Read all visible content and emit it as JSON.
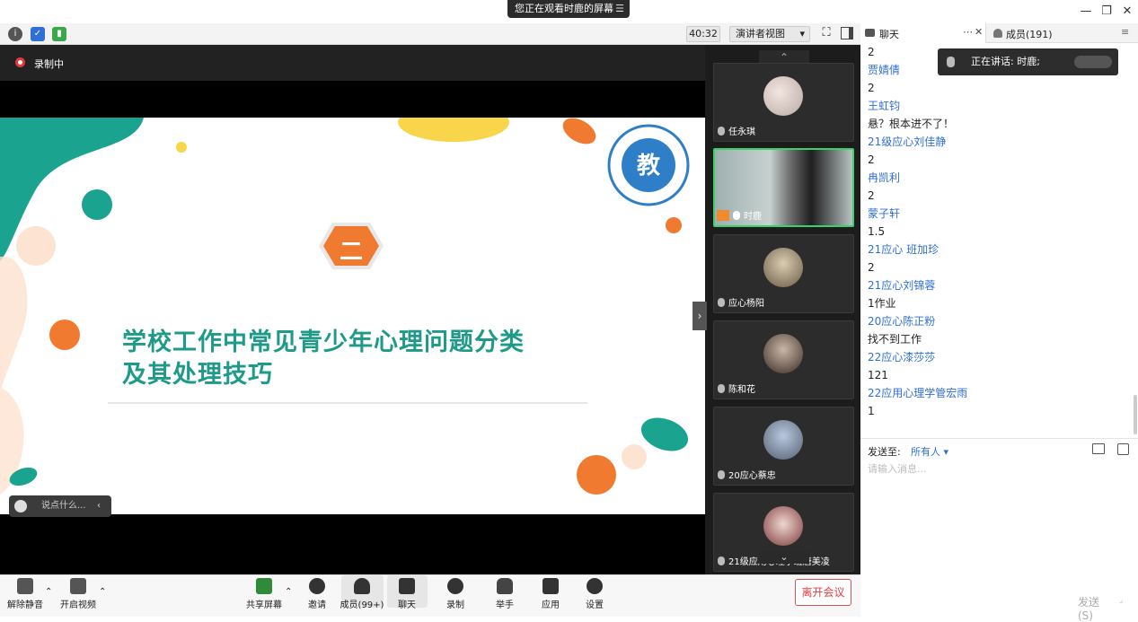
{
  "viewing_banner": "您正在观看时鹿的屏幕",
  "toolbar": {
    "timer": "40:32",
    "view_mode": "演讲者视图"
  },
  "recording": {
    "label": "录制中"
  },
  "slide": {
    "badge": "二",
    "title_line1": "学校工作中常见青少年心理问题分类",
    "title_line2": "及其处理技巧"
  },
  "chat_input_pill": "说点什么...",
  "gallery": [
    {
      "name": "任永琪"
    },
    {
      "name": "时鹿"
    },
    {
      "name": "应心杨阳"
    },
    {
      "name": "陈和花"
    },
    {
      "name": "20应心蔡忠"
    },
    {
      "name": "21级应用心理学班唐美凌"
    }
  ],
  "panel": {
    "chat_tab": "聊天",
    "members_tab": "成员(191)"
  },
  "speaker_popup": "正在讲话: 时鹿;",
  "chat_messages": [
    {
      "type": "text",
      "text": "2"
    },
    {
      "type": "name",
      "text": "贾婧倩"
    },
    {
      "type": "text",
      "text": "2"
    },
    {
      "type": "name",
      "text": "王虹钧"
    },
    {
      "type": "text",
      "text": "悬？根本进不了！"
    },
    {
      "type": "name",
      "text": "21级应心刘佳静"
    },
    {
      "type": "text",
      "text": "2"
    },
    {
      "type": "name",
      "text": "冉凯利"
    },
    {
      "type": "text",
      "text": "2"
    },
    {
      "type": "name",
      "text": "蒙子轩"
    },
    {
      "type": "text",
      "text": "1.5"
    },
    {
      "type": "name",
      "text": "21应心 班加珍"
    },
    {
      "type": "text",
      "text": "2"
    },
    {
      "type": "name",
      "text": "21应心刘锦蓉"
    },
    {
      "type": "text",
      "text": "1作业"
    },
    {
      "type": "name",
      "text": "20应心陈正粉"
    },
    {
      "type": "text",
      "text": "找不到工作"
    },
    {
      "type": "name",
      "text": "22应心漆莎莎"
    },
    {
      "type": "text",
      "text": "121"
    },
    {
      "type": "name",
      "text": "22应用心理学管宏雨"
    },
    {
      "type": "text",
      "text": "1"
    }
  ],
  "send": {
    "to_label": "发送至:",
    "to_value": "所有人",
    "placeholder": "请输入消息...",
    "send_button": "发送(S)"
  },
  "bottom": {
    "unmute": "解除静音",
    "start_video": "开启视频",
    "share_screen": "共享屏幕",
    "invite": "邀请",
    "members": "成员(99+)",
    "chat": "聊天",
    "record": "录制",
    "raise_hand": "举手",
    "apps": "应用",
    "settings": "设置",
    "leave": "离开会议"
  }
}
